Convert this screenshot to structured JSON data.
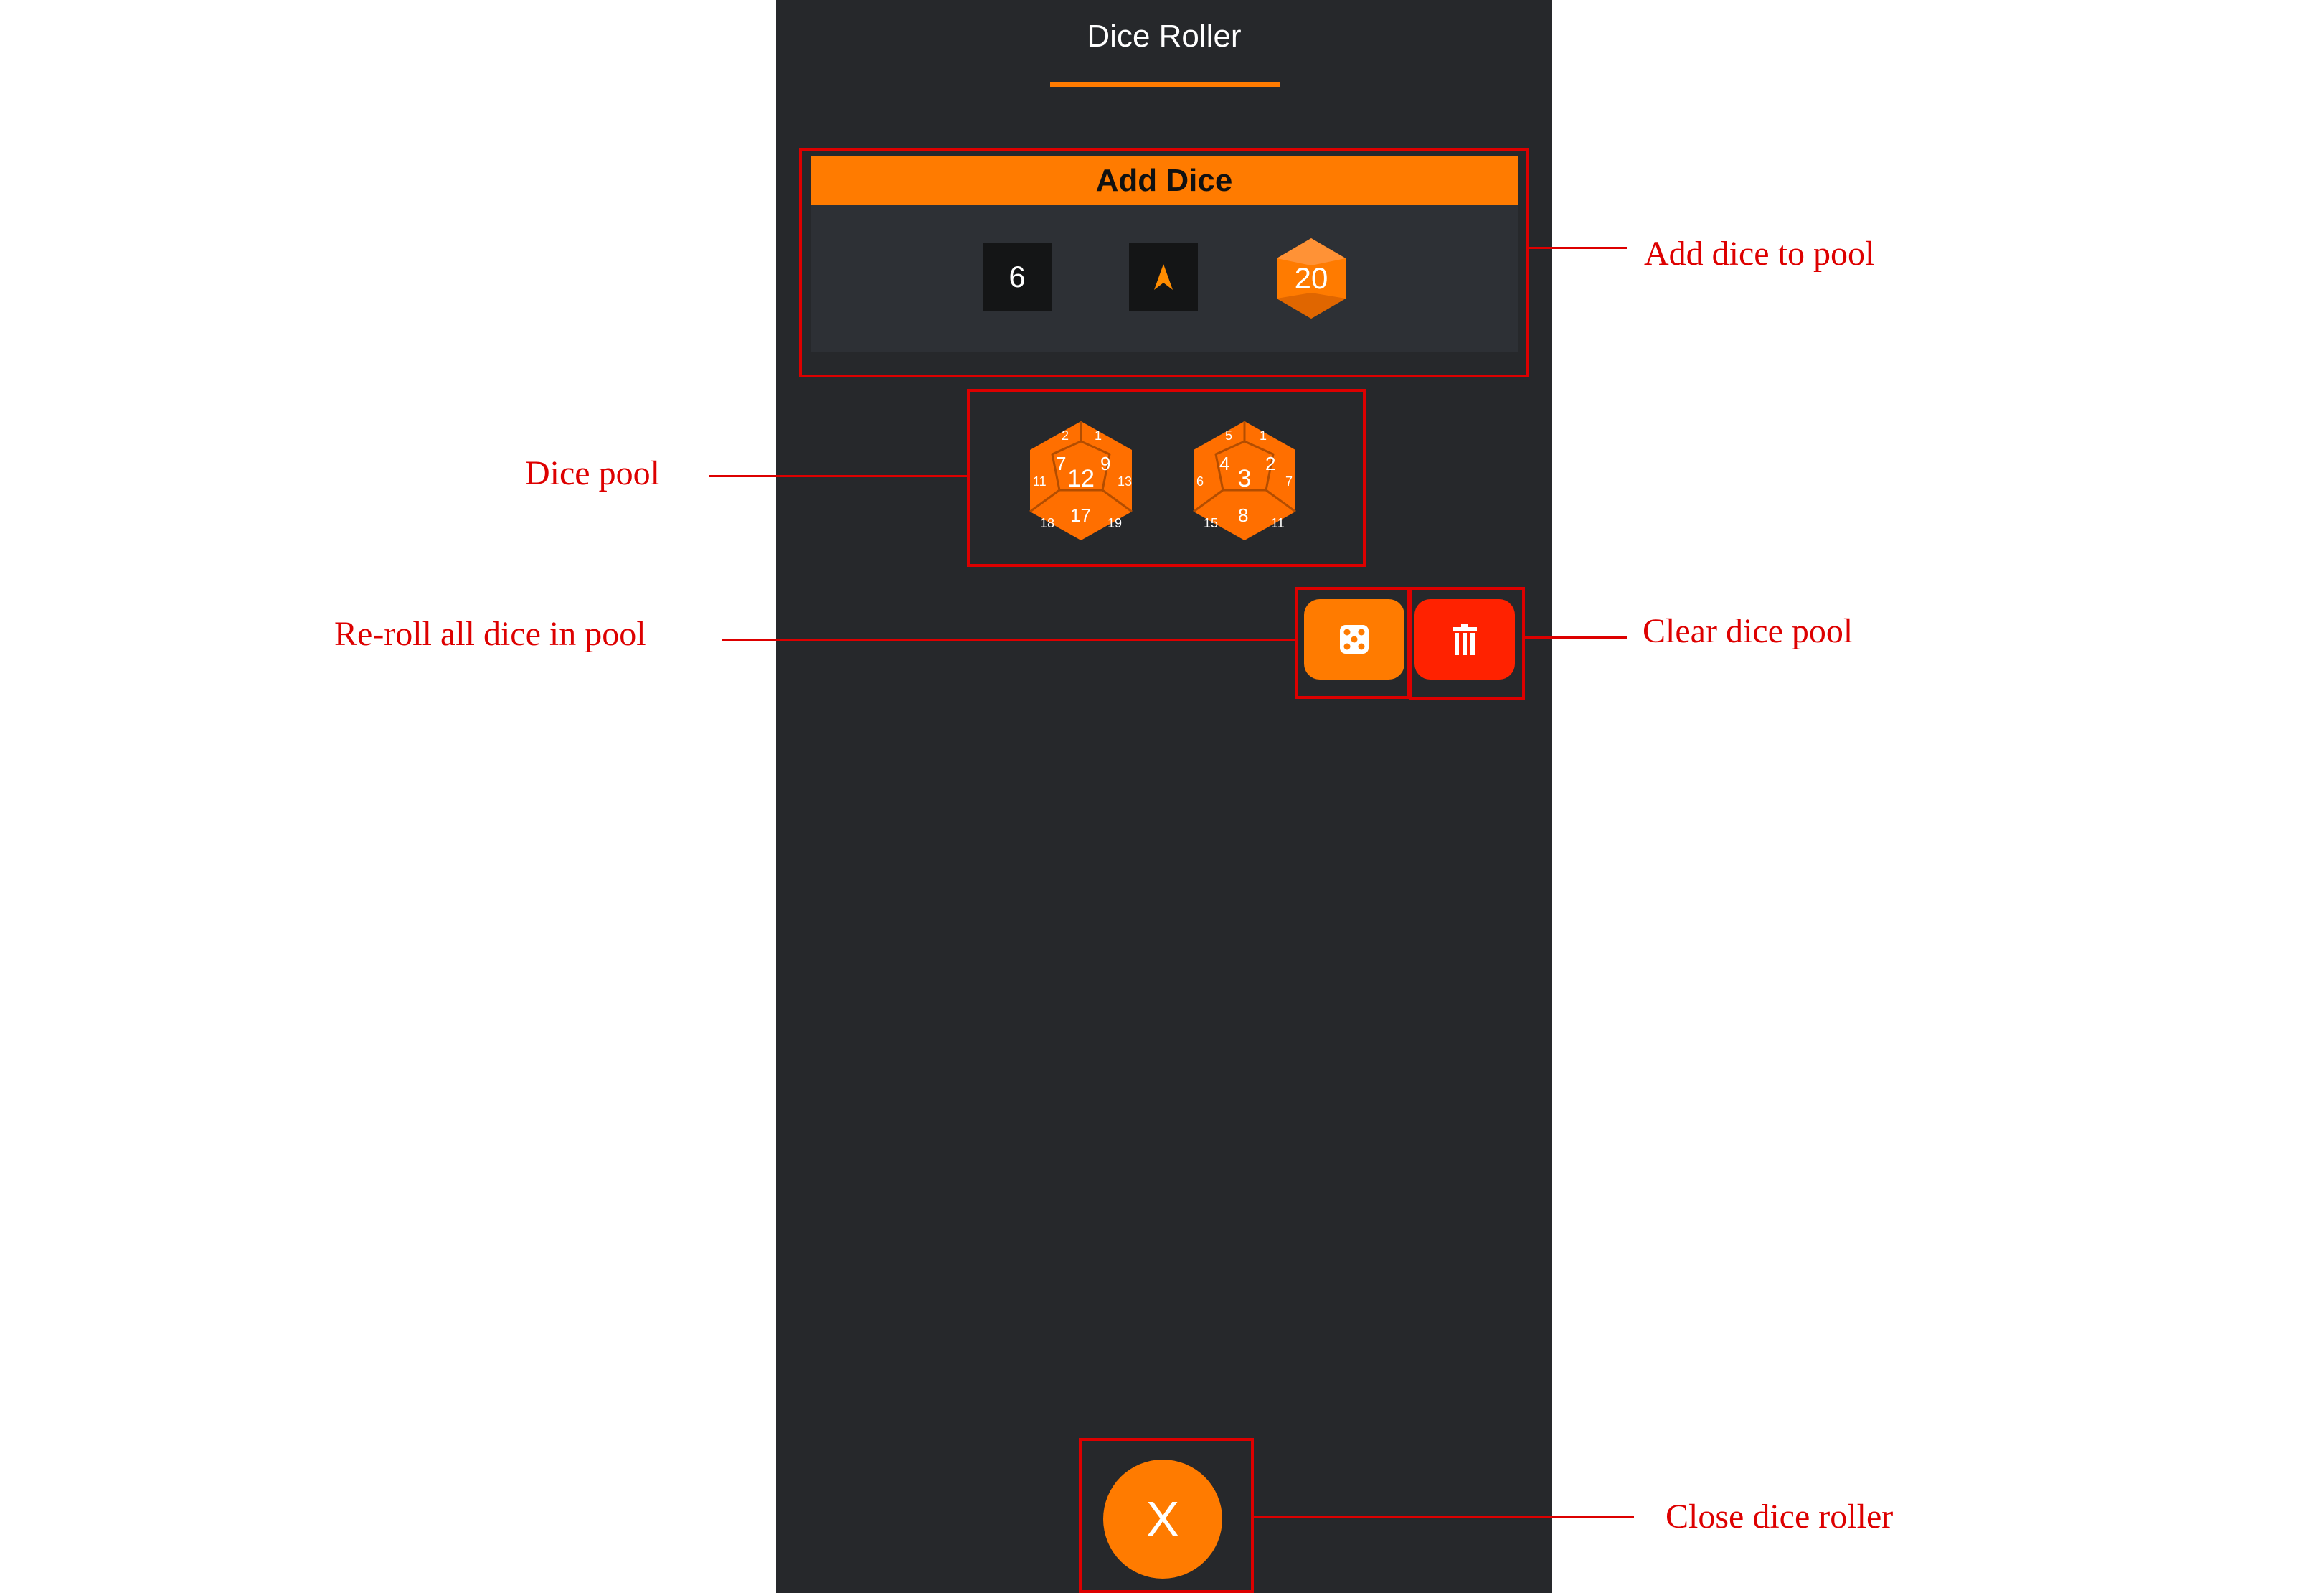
{
  "app": {
    "title": "Dice Roller"
  },
  "add_dice": {
    "header": "Add Dice",
    "dice": [
      {
        "label": "6",
        "icon": "d6-icon"
      },
      {
        "label": "",
        "icon": "d4-icon"
      },
      {
        "label": "20",
        "icon": "d20-icon"
      }
    ]
  },
  "pool": {
    "dice": [
      {
        "value": "12",
        "faces": [
          "7",
          "9",
          "2",
          "1",
          "11",
          "13",
          "17",
          "18",
          "19"
        ]
      },
      {
        "value": "3",
        "faces": [
          "4",
          "2",
          "5",
          "1",
          "6",
          "7",
          "8",
          "15",
          "11"
        ]
      }
    ]
  },
  "actions": {
    "reroll_icon": "dice-icon",
    "clear_icon": "trash-icon",
    "close_label": "X"
  },
  "annotations": {
    "add_dice": "Add dice to pool",
    "dice_pool": "Dice pool",
    "reroll": "Re-roll all dice in pool",
    "clear": "Clear dice pool",
    "close": "Close dice roller"
  },
  "colors": {
    "accent": "#ff7b00",
    "danger": "#ff2200",
    "panel_bg": "#26282b",
    "annotation": "#dd0000"
  }
}
